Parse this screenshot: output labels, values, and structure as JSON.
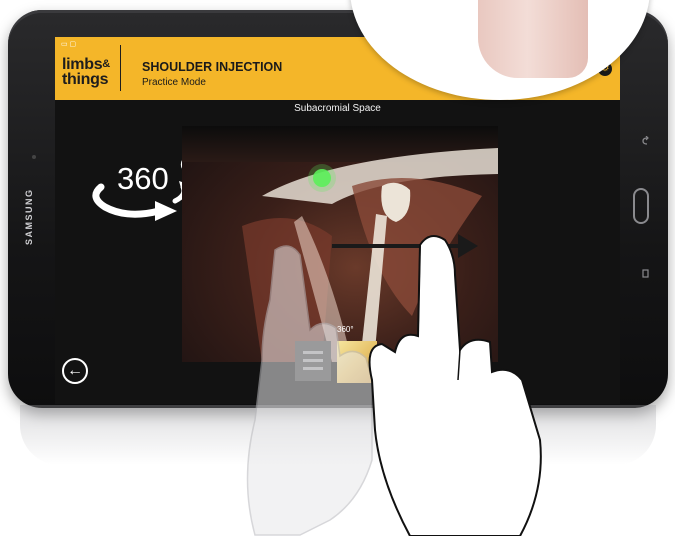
{
  "device": {
    "brand": "SAMSUNG"
  },
  "app": {
    "logo_line1": "limbs",
    "logo_amp": "&",
    "logo_line2": "things",
    "title": "SHOULDER INJECTION",
    "subtitle": "Practice Mode",
    "status_icons": "▭ ▢"
  },
  "toolbar": {
    "icons": [
      {
        "name": "link-icon",
        "glyph": "∞"
      },
      {
        "name": "settings-icon",
        "glyph": "⚙"
      }
    ]
  },
  "viewer": {
    "title": "Subacromial Space",
    "rotate_label": "360",
    "rotate_degree": "o",
    "mini_rotate_label": "360°"
  },
  "navigation": {
    "back_glyph": "←"
  },
  "colors": {
    "appbar": "#f4b629",
    "screen_bg": "#121212",
    "highlight": "#5cf05a",
    "bone": "#e8e0d8"
  }
}
